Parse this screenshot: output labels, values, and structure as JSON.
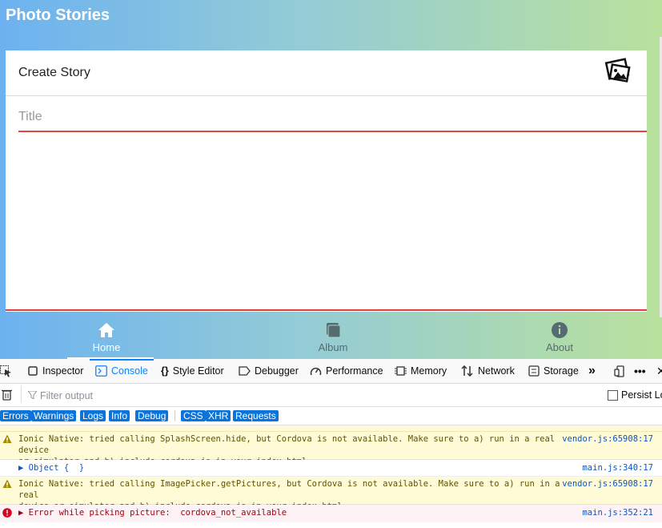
{
  "app": {
    "title": "Photo Stories",
    "card_title": "Create Story",
    "title_placeholder": "Title",
    "tabs": [
      {
        "label": "Home",
        "icon": "home-icon"
      },
      {
        "label": "Album",
        "icon": "album-icon"
      },
      {
        "label": "About",
        "icon": "info-icon"
      }
    ],
    "colors": {
      "gradient_start": "#6cb2f0",
      "gradient_end": "#b9e19c",
      "input_underline": "#e0483a"
    }
  },
  "devtools": {
    "tabs": [
      "Inspector",
      "Console",
      "Style Editor",
      "Debugger",
      "Performance",
      "Memory",
      "Network",
      "Storage"
    ],
    "active_tab": "Console",
    "filter_placeholder": "Filter output",
    "persist_logs": "Persist Logs",
    "levels": [
      "Errors",
      "Warnings",
      "Logs",
      "Info",
      "Debug",
      "CSS",
      "XHR",
      "Requests"
    ],
    "messages": [
      {
        "type": "warning",
        "text": "Ionic Native: tried calling SplashScreen.hide, but Cordova is not available. Make sure to a) run in a real device\nor simulator and b) include cordova.js in your index.html",
        "source": "vendor.js:65908:17"
      },
      {
        "type": "log",
        "text": "▶ Object {  }",
        "source": "main.js:340:17"
      },
      {
        "type": "warning",
        "text": "Ionic Native: tried calling ImagePicker.getPictures, but Cordova is not available. Make sure to a) run in a real\ndevice or simulator and b) include cordova.js in your index.html",
        "source": "vendor.js:65908:17"
      },
      {
        "type": "error",
        "text": "▶ Error while picking picture:  cordova_not_available",
        "source": "main.js:352:21"
      }
    ]
  }
}
